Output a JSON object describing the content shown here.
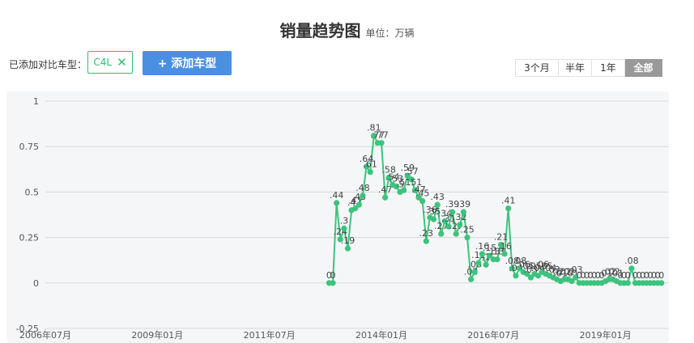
{
  "header": {
    "title": "销量趋势图",
    "unit": "单位：万辆"
  },
  "compare": {
    "label": "已添加对比车型：",
    "car": "C4L",
    "add_button": "+ 添加车型"
  },
  "range_tabs": [
    {
      "label": "3个月",
      "active": false
    },
    {
      "label": "半年",
      "active": false
    },
    {
      "label": "1年",
      "active": false
    },
    {
      "label": "全部",
      "active": true
    }
  ],
  "colors": {
    "series": "#3cc47c",
    "accent": "#4a90e2",
    "grid": "#d9d9d9",
    "tab_active": "#999999"
  },
  "chart_data": {
    "type": "line",
    "xlim": [
      "2006-07",
      "2020-06"
    ],
    "ylim": [
      -0.25,
      1
    ],
    "yticks": [
      "1",
      "0.75",
      "0.5",
      "0.25",
      "0",
      "-0.25"
    ],
    "xticks": [
      "2006年07月",
      "2009年01月",
      "2011年07月",
      "2014年01月",
      "2016年07月",
      "2019年01月"
    ],
    "grid": true,
    "series": [
      {
        "points": [
          {
            "x": "2012-11",
            "y": 0
          },
          {
            "x": "2012-12",
            "y": 0
          },
          {
            "x": "2013-01",
            "y": 0.44
          },
          {
            "x": "2013-02",
            "y": 0.24
          },
          {
            "x": "2013-03",
            "y": 0.3
          },
          {
            "x": "2013-04",
            "y": 0.19
          },
          {
            "x": "2013-05",
            "y": 0.4
          },
          {
            "x": "2013-06",
            "y": 0.41
          },
          {
            "x": "2013-07",
            "y": 0.43
          },
          {
            "x": "2013-08",
            "y": 0.48
          },
          {
            "x": "2013-09",
            "y": 0.64
          },
          {
            "x": "2013-10",
            "y": 0.61
          },
          {
            "x": "2013-11",
            "y": 0.81
          },
          {
            "x": "2013-12",
            "y": 0.77
          },
          {
            "x": "2014-01",
            "y": 0.77
          },
          {
            "x": "2014-02",
            "y": 0.47
          },
          {
            "x": "2014-03",
            "y": 0.58
          },
          {
            "x": "2014-04",
            "y": 0.54
          },
          {
            "x": "2014-05",
            "y": 0.53
          },
          {
            "x": "2014-06",
            "y": 0.5
          },
          {
            "x": "2014-07",
            "y": 0.51
          },
          {
            "x": "2014-08",
            "y": 0.59
          },
          {
            "x": "2014-09",
            "y": 0.57
          },
          {
            "x": "2014-10",
            "y": 0.51
          },
          {
            "x": "2014-11",
            "y": 0.47
          },
          {
            "x": "2014-12",
            "y": 0.45
          },
          {
            "x": "2015-01",
            "y": 0.23
          },
          {
            "x": "2015-02",
            "y": 0.36
          },
          {
            "x": "2015-03",
            "y": 0.35
          },
          {
            "x": "2015-04",
            "y": 0.43
          },
          {
            "x": "2015-05",
            "y": 0.27
          },
          {
            "x": "2015-06",
            "y": 0.34
          },
          {
            "x": "2015-07",
            "y": 0.31
          },
          {
            "x": "2015-08",
            "y": 0.39
          },
          {
            "x": "2015-09",
            "y": 0.27
          },
          {
            "x": "2015-10",
            "y": 0.32
          },
          {
            "x": "2015-11",
            "y": 0.39
          },
          {
            "x": "2015-12",
            "y": 0.25
          },
          {
            "x": "2016-01",
            "y": 0.02
          },
          {
            "x": "2016-02",
            "y": 0.06
          },
          {
            "x": "2016-03",
            "y": 0.11
          },
          {
            "x": "2016-04",
            "y": 0.16
          },
          {
            "x": "2016-05",
            "y": 0.1
          },
          {
            "x": "2016-06",
            "y": 0.15
          },
          {
            "x": "2016-07",
            "y": 0.13
          },
          {
            "x": "2016-08",
            "y": 0.13
          },
          {
            "x": "2016-09",
            "y": 0.21
          },
          {
            "x": "2016-10",
            "y": 0.16
          },
          {
            "x": "2016-11",
            "y": 0.41
          },
          {
            "x": "2016-12",
            "y": 0.08
          },
          {
            "x": "2017-01",
            "y": 0.04
          },
          {
            "x": "2017-02",
            "y": 0.08
          },
          {
            "x": "2017-03",
            "y": 0.06
          },
          {
            "x": "2017-04",
            "y": 0.05
          },
          {
            "x": "2017-05",
            "y": 0.03
          },
          {
            "x": "2017-06",
            "y": 0.05
          },
          {
            "x": "2017-07",
            "y": 0.04
          },
          {
            "x": "2017-08",
            "y": 0.06
          },
          {
            "x": "2017-09",
            "y": 0.05
          },
          {
            "x": "2017-10",
            "y": 0.04
          },
          {
            "x": "2017-11",
            "y": 0.03
          },
          {
            "x": "2017-12",
            "y": 0.02
          },
          {
            "x": "2018-01",
            "y": 0.01
          },
          {
            "x": "2018-02",
            "y": 0.02
          },
          {
            "x": "2018-03",
            "y": 0.02
          },
          {
            "x": "2018-04",
            "y": 0.01
          },
          {
            "x": "2018-05",
            "y": 0.03
          },
          {
            "x": "2018-06",
            "y": 0
          },
          {
            "x": "2018-07",
            "y": 0
          },
          {
            "x": "2018-08",
            "y": 0
          },
          {
            "x": "2018-09",
            "y": 0
          },
          {
            "x": "2018-10",
            "y": 0
          },
          {
            "x": "2018-11",
            "y": 0
          },
          {
            "x": "2018-12",
            "y": 0
          },
          {
            "x": "2019-01",
            "y": 0.01
          },
          {
            "x": "2019-02",
            "y": 0.02
          },
          {
            "x": "2019-03",
            "y": 0.02
          },
          {
            "x": "2019-04",
            "y": 0.01
          },
          {
            "x": "2019-05",
            "y": 0
          },
          {
            "x": "2019-06",
            "y": 0
          },
          {
            "x": "2019-07",
            "y": 0
          },
          {
            "x": "2019-08",
            "y": 0.08
          },
          {
            "x": "2019-09",
            "y": 0
          },
          {
            "x": "2019-10",
            "y": 0
          },
          {
            "x": "2019-11",
            "y": 0
          },
          {
            "x": "2019-12",
            "y": 0
          },
          {
            "x": "2020-01",
            "y": 0
          },
          {
            "x": "2020-02",
            "y": 0
          },
          {
            "x": "2020-03",
            "y": 0
          },
          {
            "x": "2020-04",
            "y": 0
          }
        ]
      }
    ]
  }
}
